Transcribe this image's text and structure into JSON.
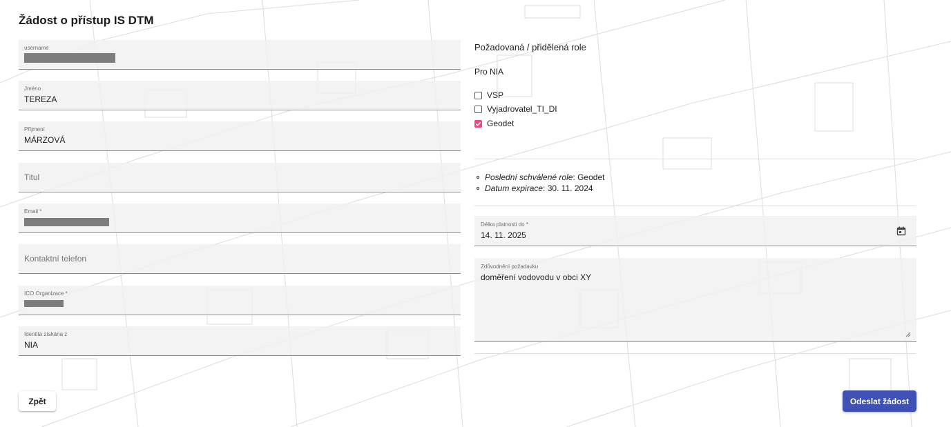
{
  "title": "Žádost o přístup IS DTM",
  "left_form": {
    "username": {
      "label": "username",
      "value_redacted": true
    },
    "jmeno": {
      "label": "Jméno",
      "value": "TEREZA"
    },
    "prijmeni": {
      "label": "Příjmení",
      "value": "MÁRZOVÁ"
    },
    "titul": {
      "placeholder": "Titul"
    },
    "email": {
      "label": "Email *",
      "value_redacted": true
    },
    "telefon": {
      "placeholder": "Kontaktní telefon"
    },
    "ico": {
      "label": "ICO Organizace *",
      "value_redacted": true
    },
    "identita": {
      "label": "Identita získána z",
      "value": "NIA"
    }
  },
  "right_panel": {
    "heading": "Požadovaná / přidělená role",
    "group_label": "Pro NIA",
    "roles": [
      {
        "label": "VSP",
        "checked": false
      },
      {
        "label": "Vyjadrovatel_TI_DI",
        "checked": false
      },
      {
        "label": "Geodet",
        "checked": true
      }
    ],
    "info": {
      "last_roles_label": "Poslední schválené role",
      "last_roles_value": ": Geodet",
      "expiry_label": "Datum expirace",
      "expiry_value": ": 30. 11. 2024"
    },
    "validity": {
      "label": "Délka platnosti do *",
      "value": "14. 11. 2025",
      "icon": "calendar-icon"
    },
    "justification": {
      "label": "Zdůvodnění požadavku",
      "value": "doměření vodovodu v obci XY"
    }
  },
  "buttons": {
    "back_label": "Zpět",
    "submit_label": "Odeslat žádost"
  },
  "colors": {
    "accent": "#3f51b5",
    "checkbox_checked": "#e94b7e",
    "field_bg": "#f0f0f0"
  }
}
